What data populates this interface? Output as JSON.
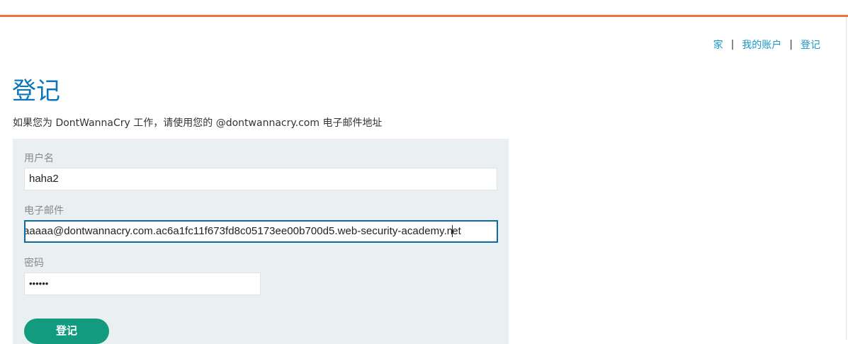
{
  "nav": {
    "home": "家",
    "my_account": "我的账户",
    "register": "登记",
    "separator": "|"
  },
  "page": {
    "title": "登记",
    "subtitle": "如果您为 DontWannaCry 工作，请使用您的 @dontwannacry.com 电子邮件地址"
  },
  "form": {
    "username_label": "用户名",
    "username_value": "haha2",
    "email_label": "电子邮件",
    "email_value_before_caret": "aaaaa@dontwannacry.com.ac6a1fc11f673fd8c05173ee00b700d5.web-security-academy.n",
    "email_value_after_caret": "et",
    "password_label": "密码",
    "password_value": "••••••",
    "submit_label": "登记"
  },
  "colors": {
    "accent_bar": "#ee7140",
    "link": "#1b97c9",
    "title": "#0a76b9",
    "button": "#139b80"
  }
}
